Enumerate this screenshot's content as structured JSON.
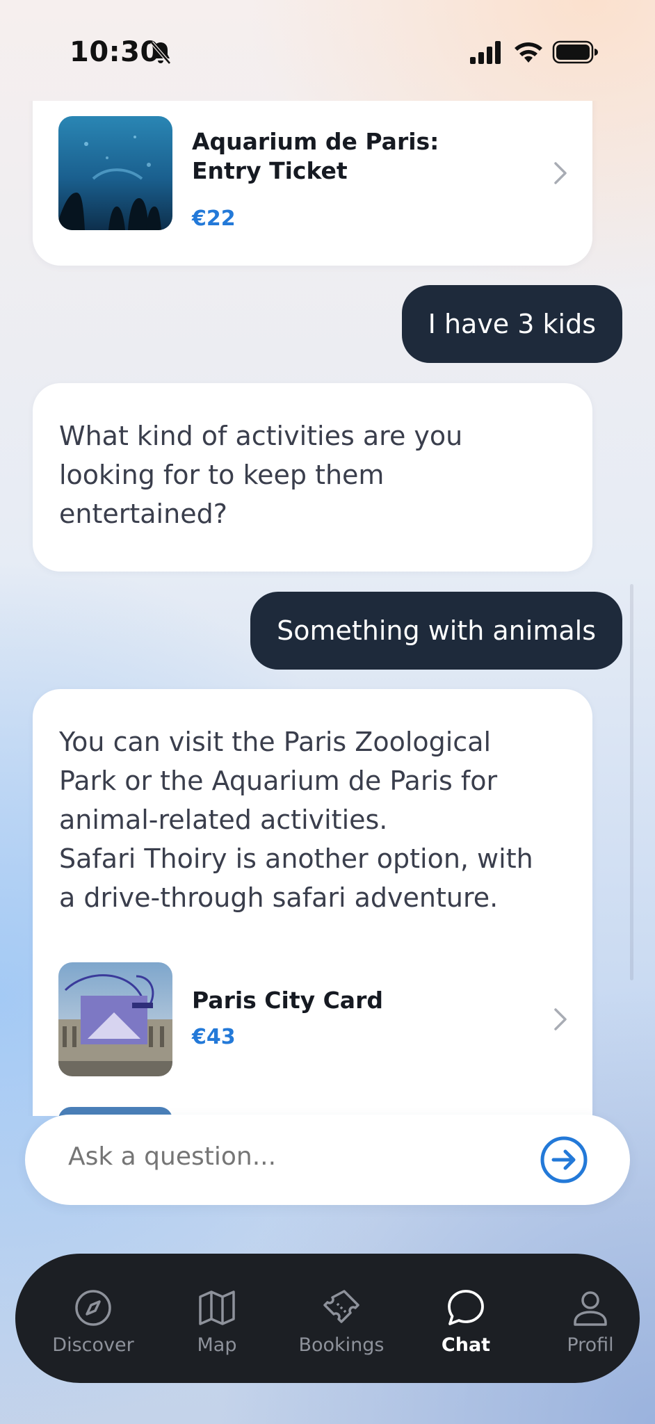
{
  "status_bar": {
    "time": "10:30",
    "icons": [
      "bell-slash-icon",
      "cellular-signal-icon",
      "wifi-icon",
      "battery-icon"
    ]
  },
  "chat": {
    "cards": [
      {
        "title": "Aquarium de Paris: Entry Ticket",
        "price": "€22",
        "image": "aquarium-photo"
      },
      {
        "title": "Paris City Card",
        "price": "€43",
        "image": "louvre-pass-photo"
      }
    ],
    "messages": [
      {
        "role": "user",
        "text": "I have 3 kids"
      },
      {
        "role": "assistant",
        "text": "What kind of activities are you\nlooking for to keep them\nentertained?"
      },
      {
        "role": "user",
        "text": "Something with animals"
      },
      {
        "role": "assistant",
        "text": "You can visit the Paris Zoological\nPark or the Aquarium de Paris for\nanimal-related activities.\nSafari Thoiry is another option, with\na drive-through safari adventure."
      }
    ]
  },
  "input": {
    "placeholder": "Ask a question...",
    "send_icon": "arrow-right-circle-icon"
  },
  "nav": {
    "items": [
      {
        "label": "Discover",
        "icon": "compass-icon",
        "active": false
      },
      {
        "label": "Map",
        "icon": "map-icon",
        "active": false
      },
      {
        "label": "Bookings",
        "icon": "ticket-icon",
        "active": false
      },
      {
        "label": "Chat",
        "icon": "chat-bubble-icon",
        "active": true
      },
      {
        "label": "Profil",
        "icon": "person-icon",
        "active": false
      }
    ]
  },
  "colors": {
    "accent": "#2379d8",
    "user_bubble": "#1e2a3b",
    "nav_background": "#1c1f24",
    "nav_active": "#ffffff",
    "nav_inactive": "#8e929b"
  }
}
